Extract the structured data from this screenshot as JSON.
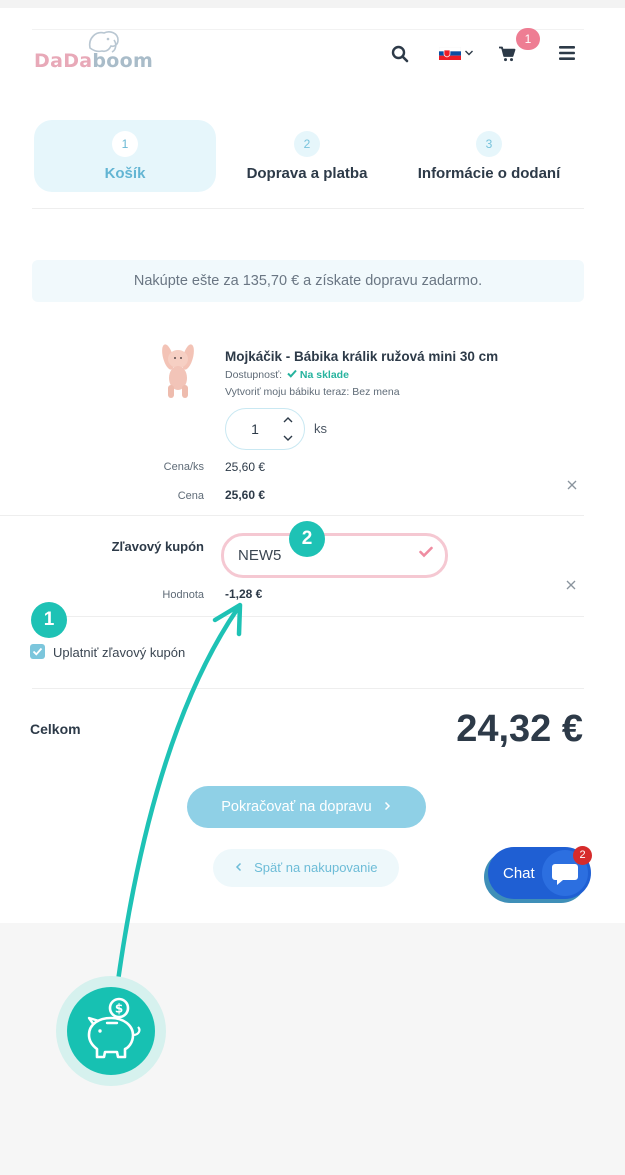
{
  "header": {
    "logo_text_part1": "DaDa",
    "logo_text_part2": "boom",
    "cart_count": "1",
    "icons": [
      "search-icon",
      "slovak-flag-icon",
      "chevron-down-icon",
      "cart-icon",
      "hamburger-menu-icon"
    ]
  },
  "steps": [
    {
      "number": "1",
      "label": "Košík",
      "active": true
    },
    {
      "number": "2",
      "label": "Doprava a platba",
      "active": false
    },
    {
      "number": "3",
      "label": "Informácie o dodaní",
      "active": false
    }
  ],
  "banner": {
    "text": "Nakúpte ešte za 135,70 € a získate dopravu zadarmo."
  },
  "product": {
    "name": "Mojkáčik - Bábika králik ružová mini 30 cm",
    "availability_label": "Dostupnosť:",
    "availability_value": "Na sklade",
    "option_text": "Vytvoriť moju bábiku teraz: Bez mena",
    "quantity": "1",
    "unit": "ks",
    "price_per_unit_label": "Cena/ks",
    "price_per_unit": "25,60 €",
    "price_label": "Cena",
    "price": "25,60 €"
  },
  "coupon": {
    "label": "Zľavový kupón",
    "code": "NEW5",
    "value_label": "Hodnota",
    "value": "-1,28 €",
    "apply_label": "Uplatniť zľavový kupón",
    "apply_checked": true
  },
  "total": {
    "label": "Celkom",
    "value": "24,32 €"
  },
  "buttons": {
    "continue": "Pokračovať na dopravu",
    "back": "Späť na nakupovanie"
  },
  "chat": {
    "label": "Chat",
    "badge": "2"
  },
  "annotations": {
    "step1": "1",
    "step2": "2"
  },
  "colors": {
    "accent_blue": "#63b5d3",
    "accent_teal": "#1ec2b5",
    "pink": "#ee7d93",
    "chat_blue": "#1f5fd3"
  }
}
